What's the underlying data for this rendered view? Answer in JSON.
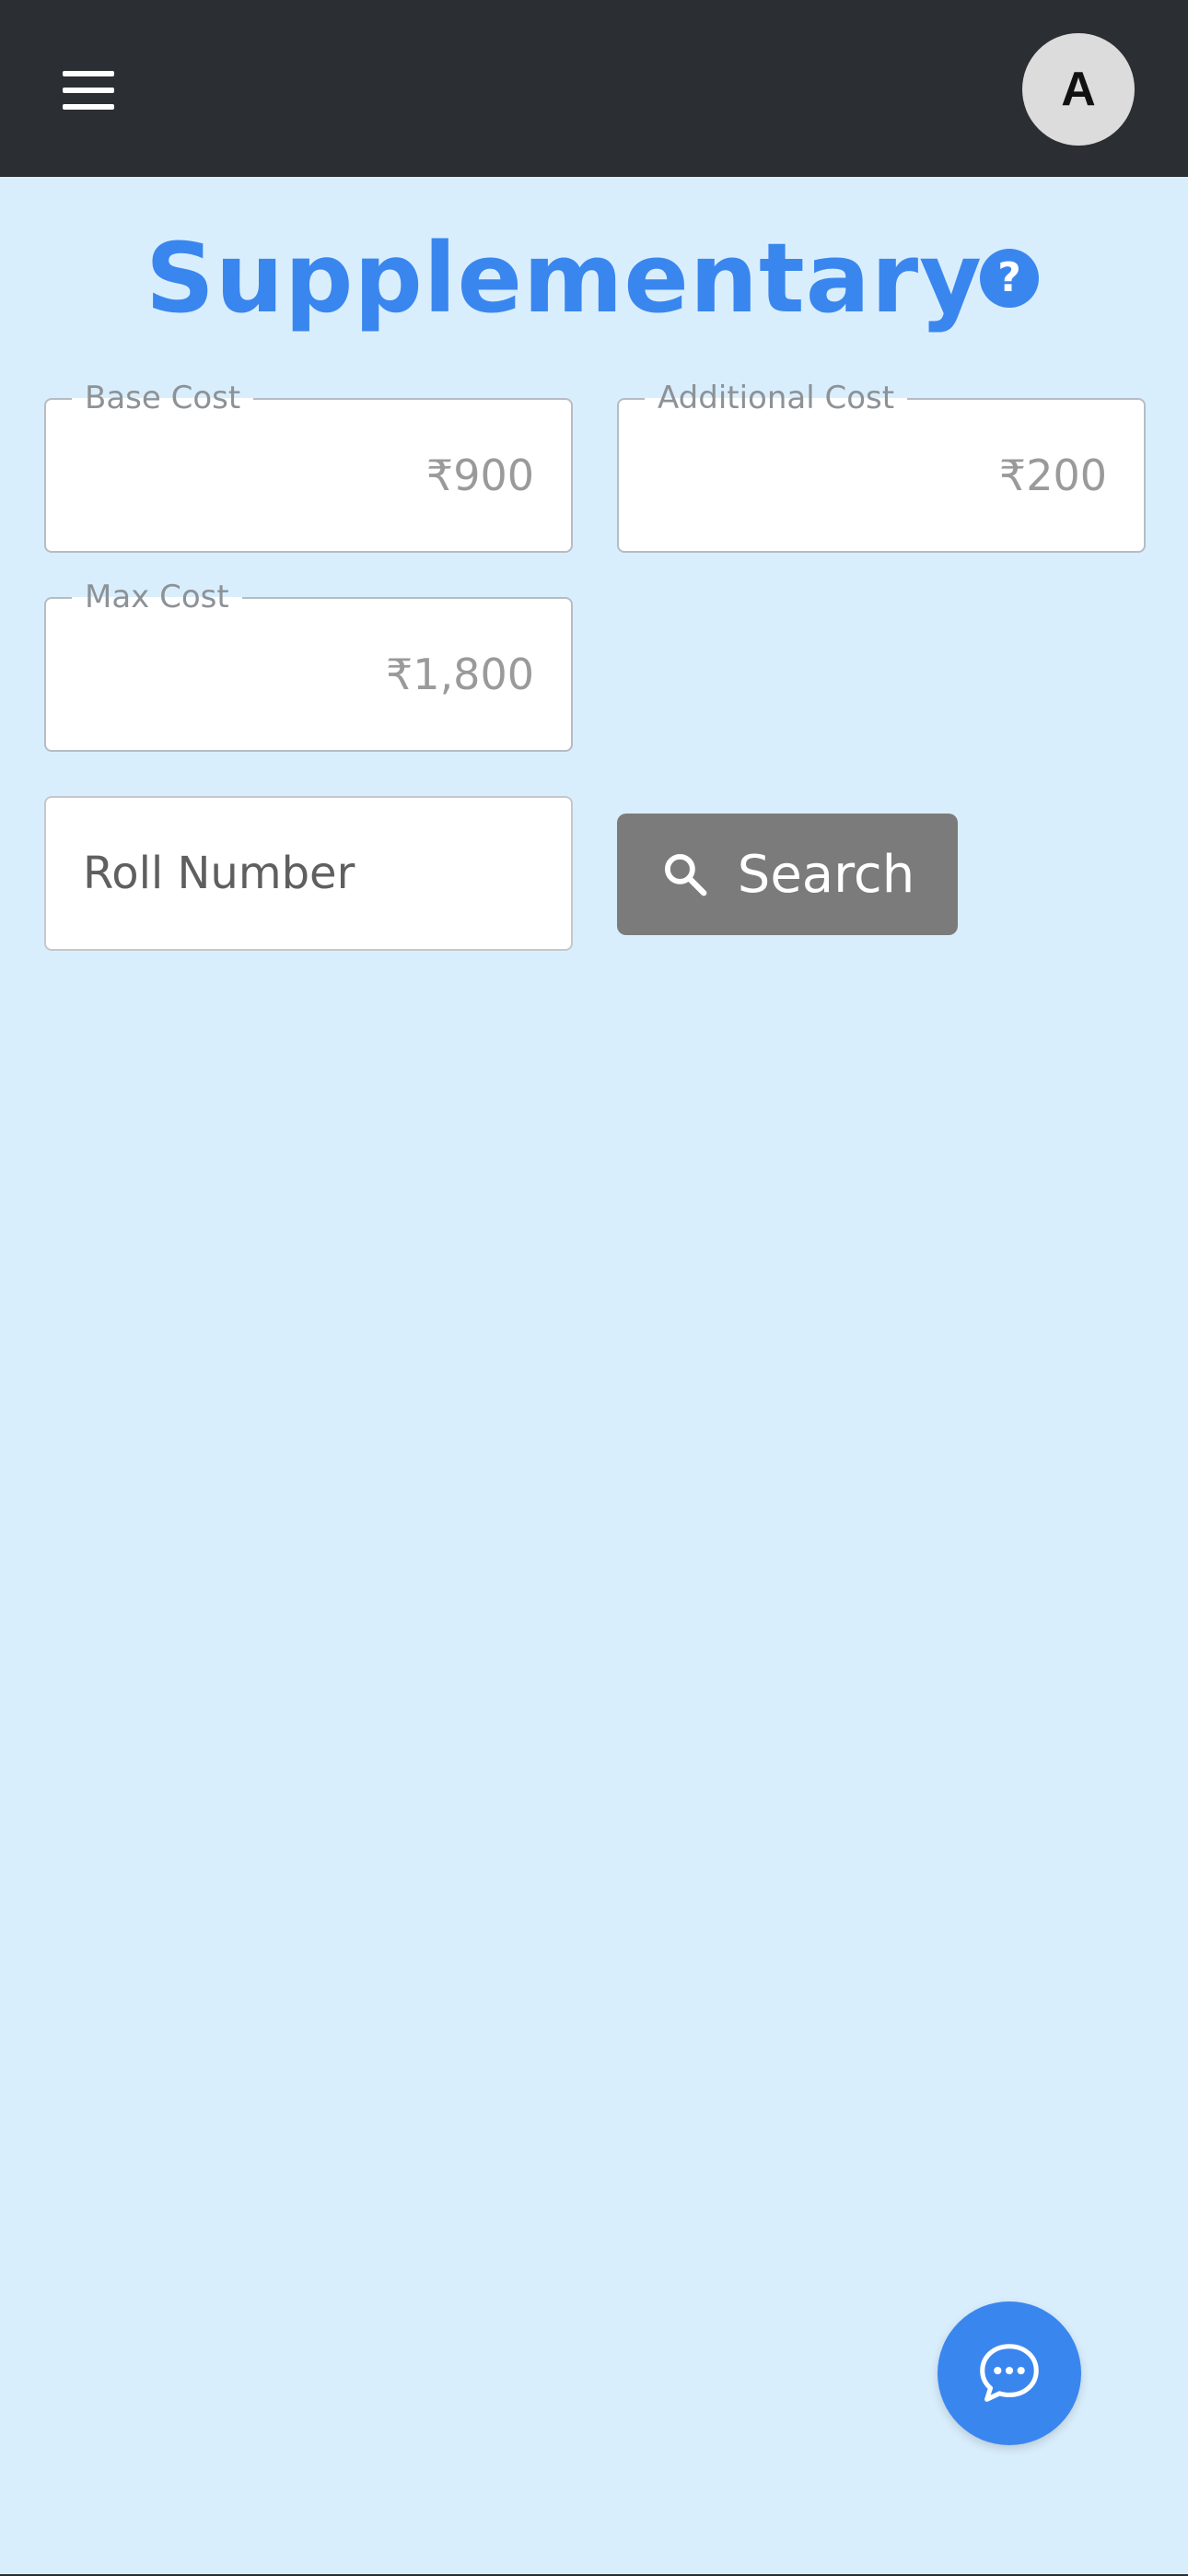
{
  "header": {
    "avatar_initial": "A",
    "menu_icon": "hamburger-menu-icon"
  },
  "page": {
    "title": "Supplementary",
    "help_icon_glyph": "?",
    "accent_color": "#3a86ef"
  },
  "fields": {
    "base_cost": {
      "label": "Base Cost",
      "value": "₹900"
    },
    "additional_cost": {
      "label": "Additional Cost",
      "value": "₹200"
    },
    "max_cost": {
      "label": "Max Cost",
      "value": "₹1,800"
    }
  },
  "search": {
    "placeholder": "Roll Number",
    "value": "",
    "button_label": "Search",
    "button_icon": "search-icon"
  },
  "chat": {
    "icon": "chat-bubble-icon"
  }
}
